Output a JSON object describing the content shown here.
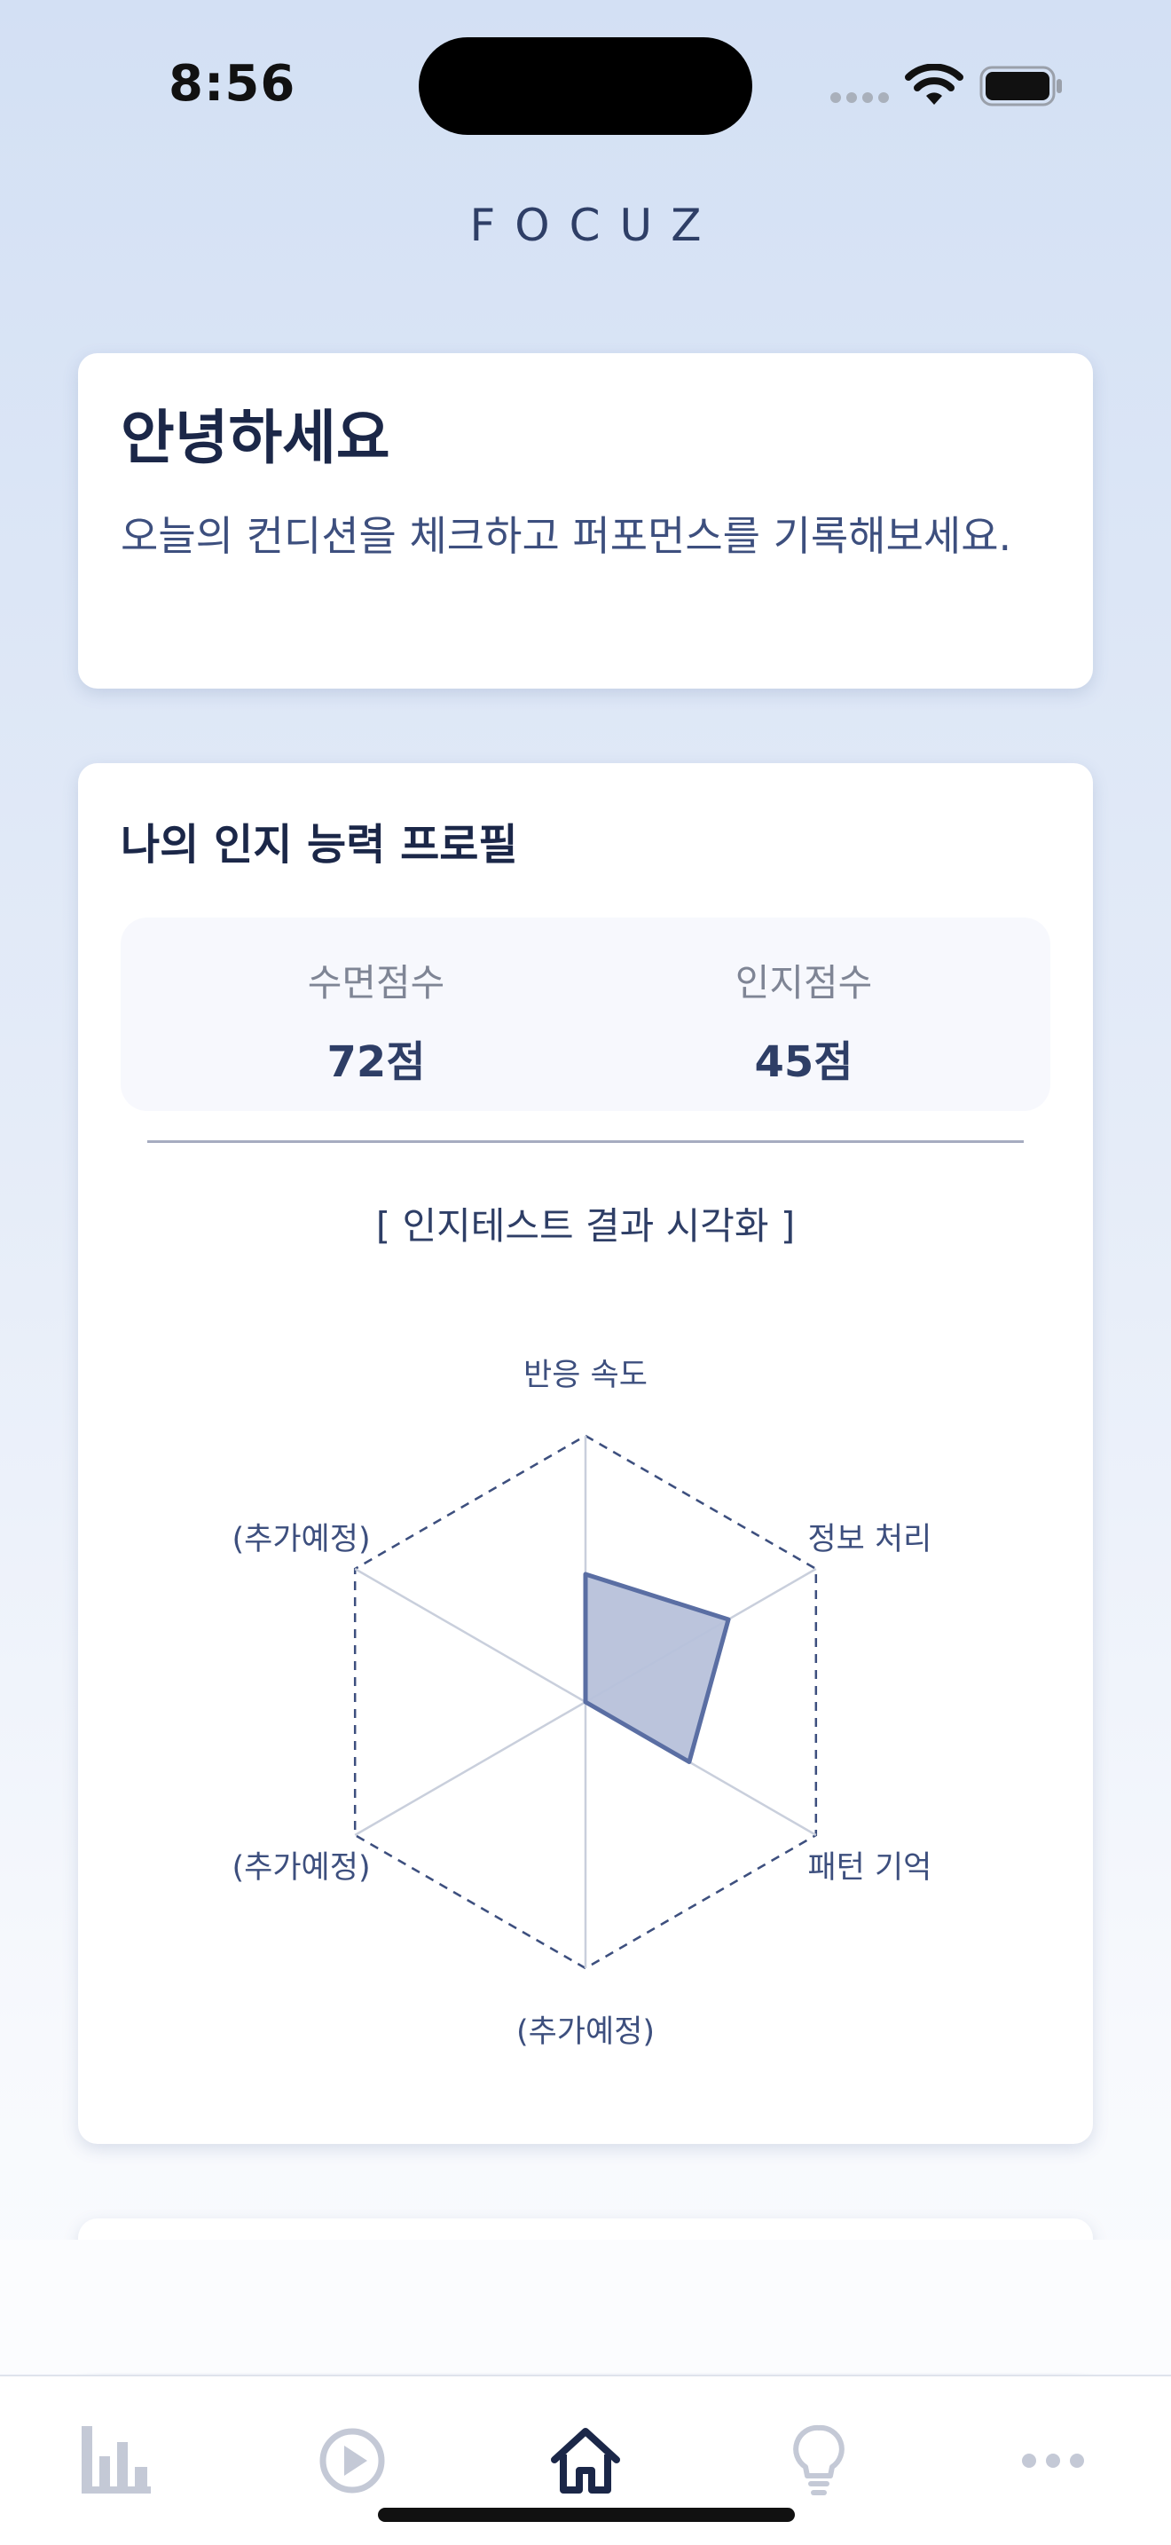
{
  "status_bar": {
    "time": "8:56"
  },
  "app": {
    "title": "FOCUZ"
  },
  "greeting": {
    "title": "안녕하세요",
    "subtitle": "오늘의 컨디션을 체크하고 퍼포먼스를 기록해보세요."
  },
  "profile": {
    "title": "나의 인지 능력 프로필",
    "sleep_label": "수면점수",
    "sleep_value": "72점",
    "cognitive_label": "인지점수",
    "cognitive_value": "45점",
    "viz_title": "[ 인지테스트 결과 시각화 ]",
    "radar": {
      "axes": [
        "반응 속도",
        "정보 처리",
        "패턴 기억",
        "(추가예정)",
        "(추가예정)",
        "(추가예정)"
      ],
      "values": [
        0.48,
        0.62,
        0.45,
        0,
        0,
        0
      ],
      "fill_color": "#b7c1da",
      "stroke_color": "#5a6ea3"
    }
  },
  "tab_bar": {
    "tabs": [
      {
        "icon": "bar-chart-icon",
        "active": false
      },
      {
        "icon": "play-circle-icon",
        "active": false
      },
      {
        "icon": "home-icon",
        "active": true
      },
      {
        "icon": "lightbulb-icon",
        "active": false
      },
      {
        "icon": "more-icon",
        "active": false
      }
    ]
  },
  "colors": {
    "accent": "#1b2748",
    "inactive": "#c4c9d6"
  }
}
